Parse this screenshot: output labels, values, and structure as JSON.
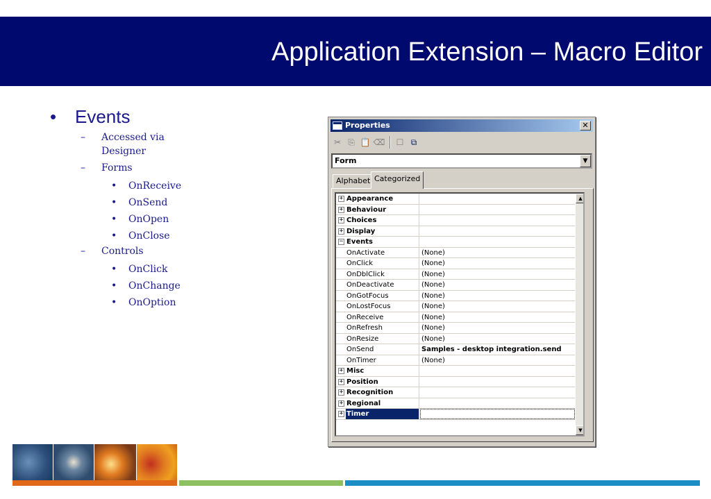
{
  "slide": {
    "title": "Application Extension – Macro Editor"
  },
  "outline": {
    "heading": "Events",
    "bullet": "•",
    "dash": "–",
    "items": [
      {
        "label": "Accessed via Designer",
        "children": []
      },
      {
        "label": "Forms",
        "children": [
          "OnReceive",
          "OnSend",
          "OnOpen",
          "OnClose"
        ]
      },
      {
        "label": "Controls",
        "children": [
          "OnClick",
          "OnChange",
          "OnOption"
        ]
      }
    ]
  },
  "properties_window": {
    "title": "Properties",
    "close_glyph": "✕",
    "toolbar_icons": [
      "cut-icon",
      "copy-icon",
      "paste-icon",
      "eraser-icon",
      "checkbox-icon",
      "pages-icon"
    ],
    "toolbar_glyphs": [
      "✂",
      "⎘",
      "📋",
      "⌫",
      "☐",
      "⧉"
    ],
    "object_selector": {
      "value": "Form",
      "arrow": "▼"
    },
    "tabs": [
      {
        "label": "Alphabetic",
        "active": false
      },
      {
        "label": "Categorized",
        "active": true
      }
    ],
    "expand_glyph": "+",
    "collapse_glyph": "−",
    "rows": [
      {
        "kind": "category",
        "expanded": false,
        "name": "Appearance",
        "value": ""
      },
      {
        "kind": "category",
        "expanded": false,
        "name": "Behaviour",
        "value": ""
      },
      {
        "kind": "category",
        "expanded": false,
        "name": "Choices",
        "value": ""
      },
      {
        "kind": "category",
        "expanded": false,
        "name": "Display",
        "value": ""
      },
      {
        "kind": "category",
        "expanded": true,
        "name": "Events",
        "value": ""
      },
      {
        "kind": "property",
        "name": "OnActivate",
        "value": "(None)"
      },
      {
        "kind": "property",
        "name": "OnClick",
        "value": "(None)"
      },
      {
        "kind": "property",
        "name": "OnDblClick",
        "value": "(None)"
      },
      {
        "kind": "property",
        "name": "OnDeactivate",
        "value": "(None)"
      },
      {
        "kind": "property",
        "name": "OnGotFocus",
        "value": "(None)"
      },
      {
        "kind": "property",
        "name": "OnLostFocus",
        "value": "(None)"
      },
      {
        "kind": "property",
        "name": "OnReceive",
        "value": "(None)"
      },
      {
        "kind": "property",
        "name": "OnRefresh",
        "value": "(None)"
      },
      {
        "kind": "property",
        "name": "OnResize",
        "value": "(None)"
      },
      {
        "kind": "property",
        "name": "OnSend",
        "value": "Samples - desktop integration.send",
        "bold": true
      },
      {
        "kind": "property",
        "name": "OnTimer",
        "value": "(None)"
      },
      {
        "kind": "category",
        "expanded": false,
        "name": "Misc",
        "value": ""
      },
      {
        "kind": "category",
        "expanded": false,
        "name": "Position",
        "value": ""
      },
      {
        "kind": "category",
        "expanded": false,
        "name": "Recognition",
        "value": ""
      },
      {
        "kind": "category",
        "expanded": false,
        "name": "Regional",
        "value": ""
      },
      {
        "kind": "category",
        "expanded": false,
        "name": "Timer",
        "value": "",
        "selected": true
      }
    ],
    "scroll_up": "▲",
    "scroll_down": "▼"
  },
  "colors": {
    "banner": "#000a6e",
    "outline_text": "#1a1a8c",
    "selection": "#0a246a"
  }
}
